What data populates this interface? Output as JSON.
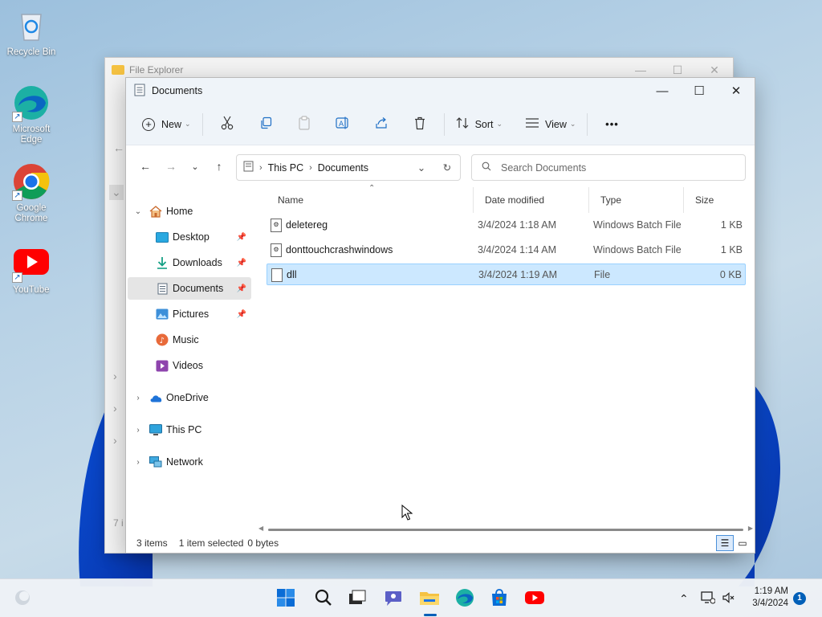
{
  "desktop": {
    "icons": [
      {
        "label": "Recycle Bin",
        "icon": "recycle-bin-icon"
      },
      {
        "label": "Microsoft Edge",
        "icon": "edge-icon"
      },
      {
        "label": "Google Chrome",
        "icon": "chrome-icon"
      },
      {
        "label": "YouTube",
        "icon": "youtube-icon"
      }
    ]
  },
  "background_window": {
    "title": "File Explorer",
    "ghost_status": "7 i"
  },
  "window": {
    "title": "Documents",
    "controls": {
      "minimize": "—",
      "maximize": "☐",
      "close": "✕"
    }
  },
  "command_bar": {
    "new_label": "New",
    "sort_label": "Sort",
    "view_label": "View",
    "more_label": "•••"
  },
  "address": {
    "crumbs": [
      "This PC",
      "Documents"
    ],
    "search_placeholder": "Search Documents"
  },
  "nav": {
    "home": "Home",
    "desktop": "Desktop",
    "downloads": "Downloads",
    "documents": "Documents",
    "pictures": "Pictures",
    "music": "Music",
    "videos": "Videos",
    "onedrive": "OneDrive",
    "thispc": "This PC",
    "network": "Network"
  },
  "columns": {
    "name": "Name",
    "date": "Date modified",
    "type": "Type",
    "size": "Size"
  },
  "files": [
    {
      "name": "deletereg",
      "date": "3/4/2024 1:18 AM",
      "type": "Windows Batch File",
      "size": "1 KB"
    },
    {
      "name": "donttouchcrashwindows",
      "date": "3/4/2024 1:14 AM",
      "type": "Windows Batch File",
      "size": "1 KB"
    },
    {
      "name": "dll",
      "date": "3/4/2024 1:19 AM",
      "type": "File",
      "size": "0 KB"
    }
  ],
  "status": {
    "count": "3 items",
    "selected": "1 item selected",
    "bytes": "0 bytes"
  },
  "taskbar": {
    "time": "1:19 AM",
    "date": "3/4/2024",
    "notifications": "1"
  },
  "colors": {
    "selection": "#cce8ff",
    "accent": "#005fb8"
  }
}
